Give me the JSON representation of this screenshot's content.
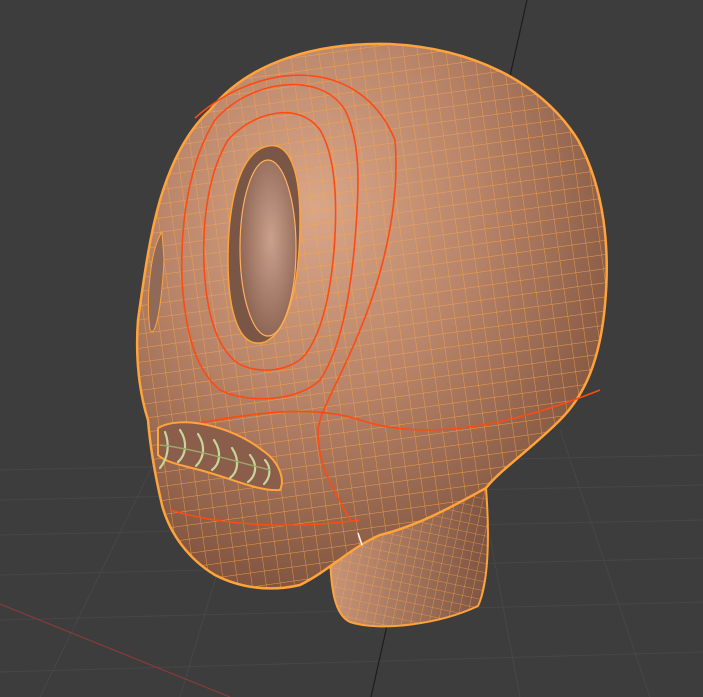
{
  "viewport": {
    "object_name": "",
    "background_color": "#3d3d3d",
    "grid_color": "#464646",
    "axis_x_color": "#8a3a3a",
    "axis_y_color": "#1d1d1d",
    "selection_outline_color": "#ff9a3c",
    "selection_edge_color": "#ff9f2e",
    "seam_color": "#ff4a12",
    "mesh_base_color": "#b57f63",
    "stitch_color": "#c9d49a",
    "icons": [
      "eye-socket-left",
      "eye-socket-right",
      "stitched-mouth"
    ]
  }
}
